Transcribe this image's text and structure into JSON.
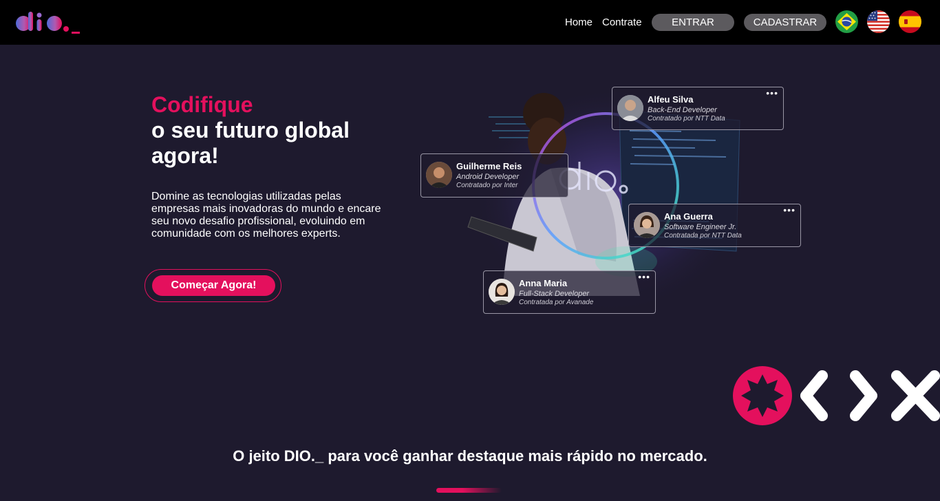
{
  "header": {
    "logo_text": "dio._",
    "nav": {
      "home": "Home",
      "hire": "Contrate"
    },
    "login_label": "ENTRAR",
    "signup_label": "CADASTRAR",
    "flags": [
      "brazil-flag-icon",
      "usa-flag-icon",
      "spain-flag-icon"
    ]
  },
  "hero": {
    "title_accent": "Codifique",
    "title_line1": "o seu futuro global",
    "title_line2": "agora!",
    "description": "Domine as tecnologias utilizadas pelas empresas mais inovadoras do mundo e encare seu novo desafio profissional, evoluindo em comunidade com os melhores experts.",
    "cta_label": "Começar Agora!"
  },
  "profiles": [
    {
      "name": "Alfeu Silva",
      "role": "Back-End Developer",
      "hired": "Contratado por NTT Data"
    },
    {
      "name": "Guilherme Reis",
      "role": "Android Developer",
      "hired": "Contratado por Inter"
    },
    {
      "name": "Ana Guerra",
      "role": "Software Engineer Jr.",
      "hired": "Contratada por NTT Data"
    },
    {
      "name": "Anna Maria",
      "role": "Full-Stack Developer",
      "hired": "Contratada por Avanade"
    }
  ],
  "menu_glyph": "•••",
  "tagline": "O jeito DIO._ para você ganhar destaque mais rápido no mercado.",
  "colors": {
    "brand": "#e4105d",
    "background": "#1e1a2e",
    "header": "#000000",
    "button": "#5c5a5e"
  }
}
